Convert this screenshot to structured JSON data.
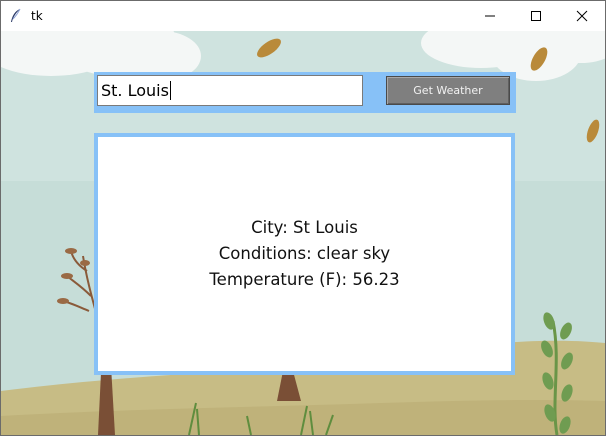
{
  "window": {
    "title": "tk",
    "icon": "feather-icon",
    "controls": {
      "minimize": "minimize-icon",
      "maximize": "maximize-icon",
      "close": "close-icon"
    }
  },
  "search": {
    "city_value": "St. Louis",
    "button_label": "Get Weather"
  },
  "result": {
    "city_line": "City: St Louis",
    "conditions_line": "Conditions: clear sky",
    "temperature_line": "Temperature (F): 56.23"
  },
  "colors": {
    "frame_accent": "#87c1f7",
    "button_bg": "#7f7f7f",
    "sky": "#c9dedb",
    "grass": "#c7bc85"
  }
}
